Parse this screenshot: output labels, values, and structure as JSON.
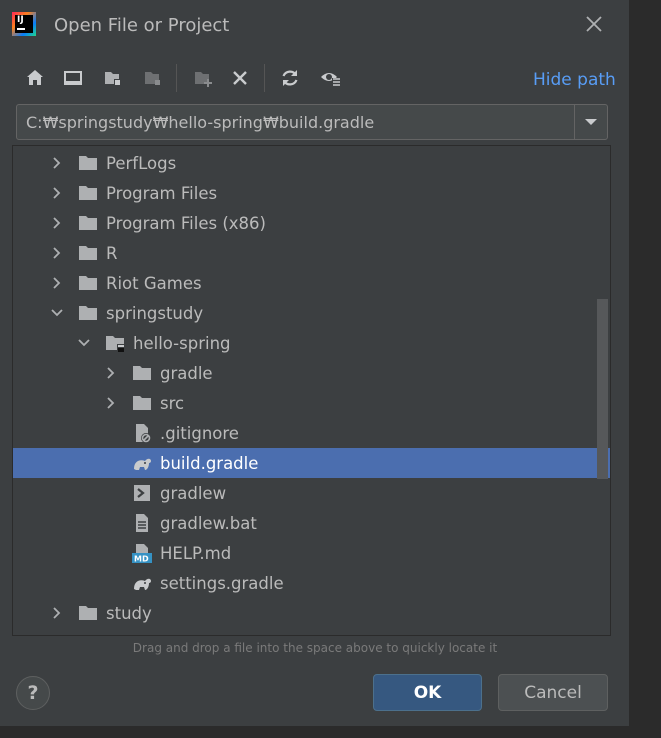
{
  "window": {
    "title": "Open File or Project",
    "logo_text": "IJ"
  },
  "toolbar": {
    "buttons": [
      {
        "name": "home-icon"
      },
      {
        "name": "desktop-icon"
      },
      {
        "name": "project-folder-icon"
      },
      {
        "name": "module-folder-icon"
      },
      {
        "name": "new-folder-icon"
      },
      {
        "name": "delete-icon"
      },
      {
        "name": "refresh-icon"
      },
      {
        "name": "show-hidden-icon"
      }
    ],
    "hide_path_label": "Hide path"
  },
  "path": {
    "value": "C:₩springstudy₩hello-spring₩build.gradle"
  },
  "tree": {
    "items": [
      {
        "label": "PerfLogs",
        "level": 0,
        "icon": "folder",
        "expanded": false
      },
      {
        "label": "Program Files",
        "level": 0,
        "icon": "folder",
        "expanded": false
      },
      {
        "label": "Program Files (x86)",
        "level": 0,
        "icon": "folder",
        "expanded": false
      },
      {
        "label": "R",
        "level": 0,
        "icon": "folder",
        "expanded": false
      },
      {
        "label": "Riot Games",
        "level": 0,
        "icon": "folder",
        "expanded": false
      },
      {
        "label": "springstudy",
        "level": 0,
        "icon": "folder",
        "expanded": true
      },
      {
        "label": "hello-spring",
        "level": 1,
        "icon": "project-folder",
        "expanded": true
      },
      {
        "label": "gradle",
        "level": 2,
        "icon": "folder",
        "expanded": false
      },
      {
        "label": "src",
        "level": 2,
        "icon": "folder",
        "expanded": false
      },
      {
        "label": ".gitignore",
        "level": 2,
        "icon": "ignore-file",
        "leaf": true
      },
      {
        "label": "build.gradle",
        "level": 2,
        "icon": "gradle-file",
        "leaf": true,
        "selected": true
      },
      {
        "label": "gradlew",
        "level": 2,
        "icon": "shell-file",
        "leaf": true
      },
      {
        "label": "gradlew.bat",
        "level": 2,
        "icon": "text-file",
        "leaf": true
      },
      {
        "label": "HELP.md",
        "level": 2,
        "icon": "markdown-file",
        "leaf": true
      },
      {
        "label": "settings.gradle",
        "level": 2,
        "icon": "gradle-file",
        "leaf": true
      },
      {
        "label": "study",
        "level": 0,
        "icon": "folder",
        "expanded": false
      },
      {
        "label": "",
        "level": 0,
        "icon": "folder",
        "expanded": false
      }
    ]
  },
  "hint": "Drag and drop a file into the space above to quickly locate it",
  "footer": {
    "help_label": "?",
    "ok_label": "OK",
    "cancel_label": "Cancel"
  },
  "colors": {
    "background": "#3c3f41",
    "selection": "#4b6eaf",
    "link": "#589df6",
    "primary_button": "#365880"
  }
}
